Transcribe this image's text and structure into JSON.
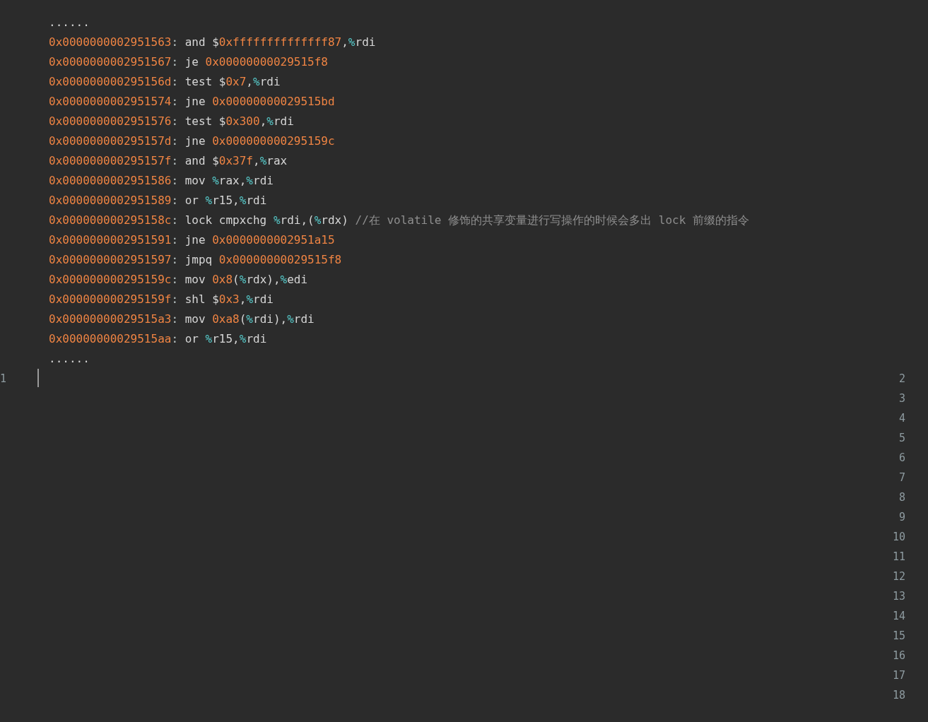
{
  "code_lines": [
    {
      "tokens": [
        {
          "t": "......",
          "kind": "plain"
        }
      ]
    },
    {
      "tokens": [
        {
          "t": "0x0000000002951563",
          "kind": "addr"
        },
        {
          "t": ": ",
          "kind": "punct"
        },
        {
          "t": "and $",
          "kind": "plain"
        },
        {
          "t": "0xffffffffffffff87",
          "kind": "num"
        },
        {
          "t": ",",
          "kind": "plain"
        },
        {
          "t": "%",
          "kind": "reg"
        },
        {
          "t": "rdi",
          "kind": "plain"
        }
      ]
    },
    {
      "tokens": [
        {
          "t": "0x0000000002951567",
          "kind": "addr"
        },
        {
          "t": ": ",
          "kind": "punct"
        },
        {
          "t": "je ",
          "kind": "plain"
        },
        {
          "t": "0x00000000029515f8",
          "kind": "num"
        }
      ]
    },
    {
      "tokens": [
        {
          "t": "0x000000000295156d",
          "kind": "addr"
        },
        {
          "t": ": ",
          "kind": "punct"
        },
        {
          "t": "test $",
          "kind": "plain"
        },
        {
          "t": "0x7",
          "kind": "num"
        },
        {
          "t": ",",
          "kind": "plain"
        },
        {
          "t": "%",
          "kind": "reg"
        },
        {
          "t": "rdi",
          "kind": "plain"
        }
      ]
    },
    {
      "tokens": [
        {
          "t": "0x0000000002951574",
          "kind": "addr"
        },
        {
          "t": ": ",
          "kind": "punct"
        },
        {
          "t": "jne ",
          "kind": "plain"
        },
        {
          "t": "0x00000000029515bd",
          "kind": "num"
        }
      ]
    },
    {
      "tokens": [
        {
          "t": "0x0000000002951576",
          "kind": "addr"
        },
        {
          "t": ": ",
          "kind": "punct"
        },
        {
          "t": "test $",
          "kind": "plain"
        },
        {
          "t": "0x300",
          "kind": "num"
        },
        {
          "t": ",",
          "kind": "plain"
        },
        {
          "t": "%",
          "kind": "reg"
        },
        {
          "t": "rdi",
          "kind": "plain"
        }
      ]
    },
    {
      "tokens": [
        {
          "t": "0x000000000295157d",
          "kind": "addr"
        },
        {
          "t": ": ",
          "kind": "punct"
        },
        {
          "t": "jne ",
          "kind": "plain"
        },
        {
          "t": "0x000000000295159c",
          "kind": "num"
        }
      ]
    },
    {
      "tokens": [
        {
          "t": "0x000000000295157f",
          "kind": "addr"
        },
        {
          "t": ": ",
          "kind": "punct"
        },
        {
          "t": "and $",
          "kind": "plain"
        },
        {
          "t": "0x37f",
          "kind": "num"
        },
        {
          "t": ",",
          "kind": "plain"
        },
        {
          "t": "%",
          "kind": "reg"
        },
        {
          "t": "rax",
          "kind": "plain"
        }
      ]
    },
    {
      "tokens": [
        {
          "t": "0x0000000002951586",
          "kind": "addr"
        },
        {
          "t": ": ",
          "kind": "punct"
        },
        {
          "t": "mov ",
          "kind": "plain"
        },
        {
          "t": "%",
          "kind": "reg"
        },
        {
          "t": "rax,",
          "kind": "plain"
        },
        {
          "t": "%",
          "kind": "reg"
        },
        {
          "t": "rdi",
          "kind": "plain"
        }
      ]
    },
    {
      "tokens": [
        {
          "t": "0x0000000002951589",
          "kind": "addr"
        },
        {
          "t": ": ",
          "kind": "punct"
        },
        {
          "t": "or ",
          "kind": "plain"
        },
        {
          "t": "%",
          "kind": "reg"
        },
        {
          "t": "r15,",
          "kind": "plain"
        },
        {
          "t": "%",
          "kind": "reg"
        },
        {
          "t": "rdi",
          "kind": "plain"
        }
      ]
    },
    {
      "tokens": [
        {
          "t": "0x000000000295158c",
          "kind": "addr"
        },
        {
          "t": ": ",
          "kind": "punct"
        },
        {
          "t": "lock cmpxchg ",
          "kind": "plain"
        },
        {
          "t": "%",
          "kind": "reg"
        },
        {
          "t": "rdi,(",
          "kind": "plain"
        },
        {
          "t": "%",
          "kind": "reg"
        },
        {
          "t": "rdx) ",
          "kind": "plain"
        },
        {
          "t": "//在 volatile 修饰的共享变量进行写操作的时候会多出 lock 前缀的指令",
          "kind": "comment"
        }
      ]
    },
    {
      "tokens": [
        {
          "t": "0x0000000002951591",
          "kind": "addr"
        },
        {
          "t": ": ",
          "kind": "punct"
        },
        {
          "t": "jne ",
          "kind": "plain"
        },
        {
          "t": "0x0000000002951a15",
          "kind": "num"
        }
      ]
    },
    {
      "tokens": [
        {
          "t": "0x0000000002951597",
          "kind": "addr"
        },
        {
          "t": ": ",
          "kind": "punct"
        },
        {
          "t": "jmpq ",
          "kind": "plain"
        },
        {
          "t": "0x00000000029515f8",
          "kind": "num"
        }
      ]
    },
    {
      "tokens": [
        {
          "t": "0x000000000295159c",
          "kind": "addr"
        },
        {
          "t": ": ",
          "kind": "punct"
        },
        {
          "t": "mov ",
          "kind": "plain"
        },
        {
          "t": "0x8",
          "kind": "num"
        },
        {
          "t": "(",
          "kind": "plain"
        },
        {
          "t": "%",
          "kind": "reg"
        },
        {
          "t": "rdx),",
          "kind": "plain"
        },
        {
          "t": "%",
          "kind": "reg"
        },
        {
          "t": "edi",
          "kind": "plain"
        }
      ]
    },
    {
      "tokens": [
        {
          "t": "0x000000000295159f",
          "kind": "addr"
        },
        {
          "t": ": ",
          "kind": "punct"
        },
        {
          "t": "shl $",
          "kind": "plain"
        },
        {
          "t": "0x3",
          "kind": "num"
        },
        {
          "t": ",",
          "kind": "plain"
        },
        {
          "t": "%",
          "kind": "reg"
        },
        {
          "t": "rdi",
          "kind": "plain"
        }
      ]
    },
    {
      "tokens": [
        {
          "t": "0x00000000029515a3",
          "kind": "addr"
        },
        {
          "t": ": ",
          "kind": "punct"
        },
        {
          "t": "mov ",
          "kind": "plain"
        },
        {
          "t": "0xa8",
          "kind": "num"
        },
        {
          "t": "(",
          "kind": "plain"
        },
        {
          "t": "%",
          "kind": "reg"
        },
        {
          "t": "rdi),",
          "kind": "plain"
        },
        {
          "t": "%",
          "kind": "reg"
        },
        {
          "t": "rdi",
          "kind": "plain"
        }
      ]
    },
    {
      "tokens": [
        {
          "t": "0x00000000029515aa",
          "kind": "addr"
        },
        {
          "t": ": ",
          "kind": "punct"
        },
        {
          "t": "or ",
          "kind": "plain"
        },
        {
          "t": "%",
          "kind": "reg"
        },
        {
          "t": "r15,",
          "kind": "plain"
        },
        {
          "t": "%",
          "kind": "reg"
        },
        {
          "t": "rdi",
          "kind": "plain"
        }
      ]
    },
    {
      "tokens": [
        {
          "t": "......",
          "kind": "plain"
        }
      ]
    }
  ],
  "editor": {
    "current_line_number": "1",
    "line_numbers": [
      "2",
      "3",
      "4",
      "5",
      "6",
      "7",
      "8",
      "9",
      "10",
      "11",
      "12",
      "13",
      "14",
      "15",
      "16",
      "17",
      "18"
    ]
  }
}
